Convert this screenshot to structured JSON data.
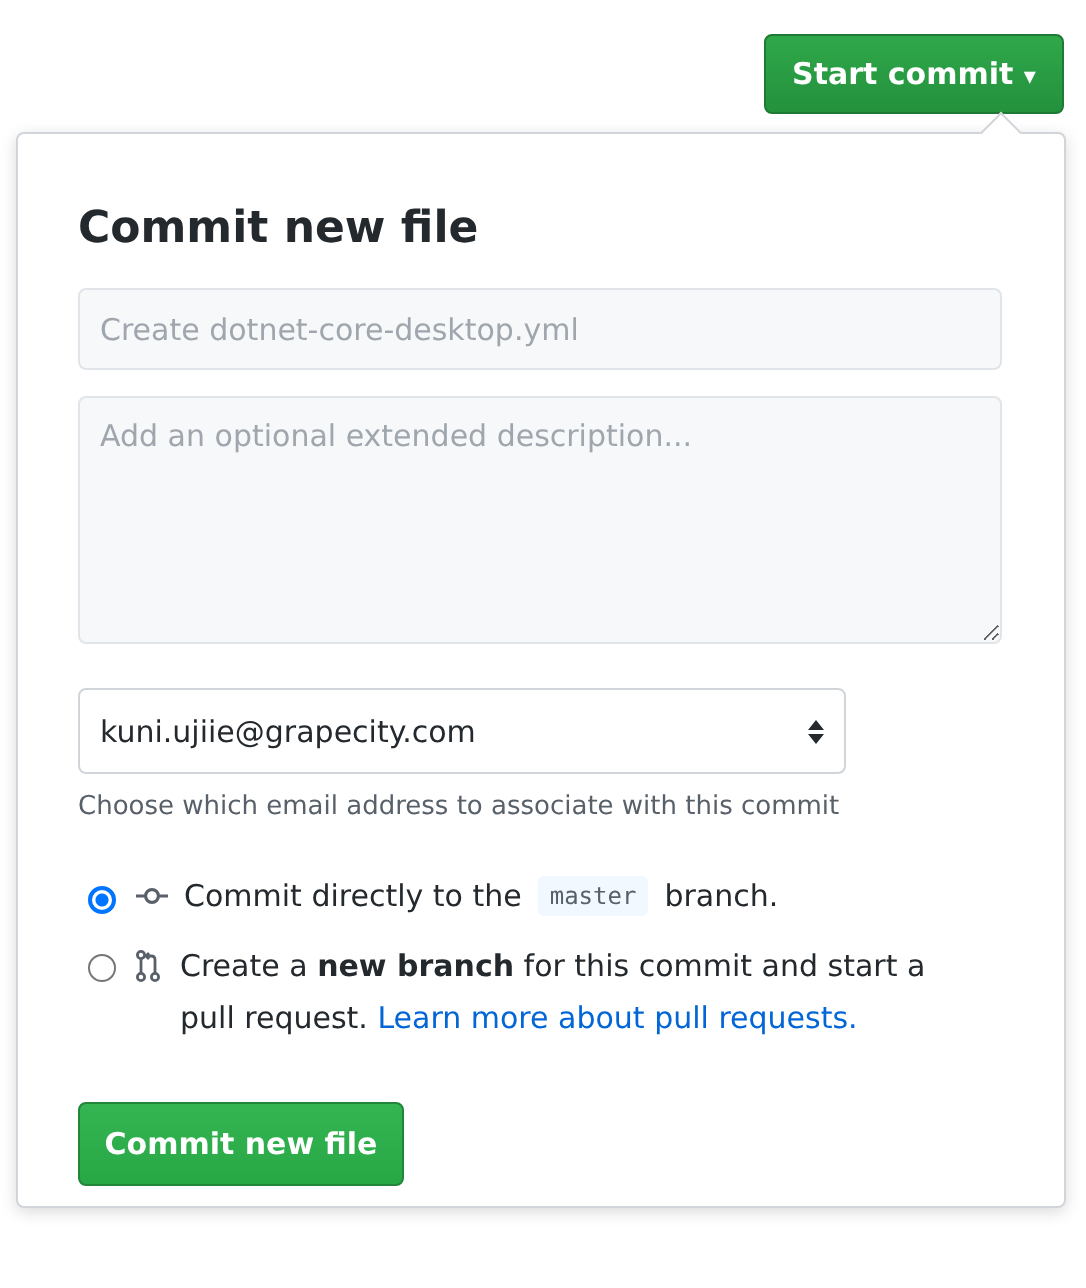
{
  "start_button": {
    "label": "Start commit",
    "caret": "▾"
  },
  "dialog": {
    "title": "Commit new file",
    "summary": {
      "placeholder": "Create dotnet-core-desktop.yml"
    },
    "description": {
      "placeholder": "Add an optional extended description..."
    },
    "email": {
      "value": "kuni.ujiie@grapecity.com",
      "hint": "Choose which email address to associate with this commit"
    },
    "options": [
      {
        "kind": "direct",
        "selected": true,
        "text": "Commit directly to the",
        "code": "master",
        "text_after": "branch."
      },
      {
        "kind": "new-branch",
        "selected": false,
        "text": "Create a **new branch** for this commit and start a pull request.",
        "link": "Learn more about pull requests."
      }
    ],
    "submit": "Commit new file"
  }
}
